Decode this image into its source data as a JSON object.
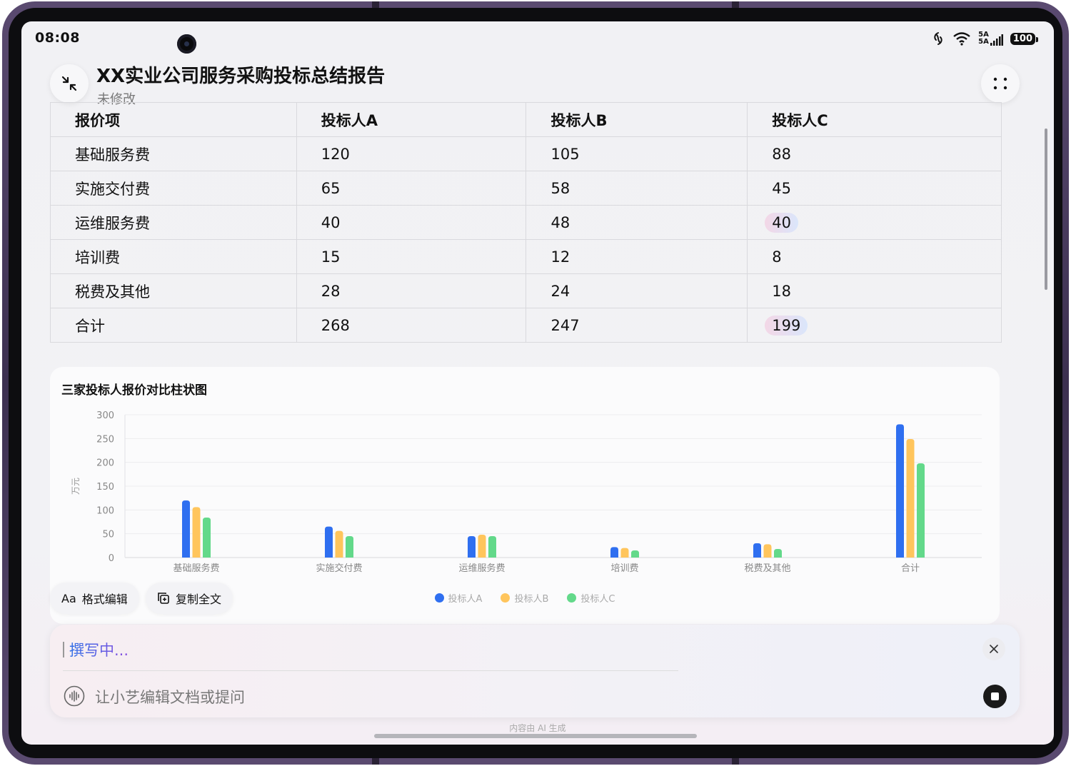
{
  "status_bar": {
    "time": "08:08",
    "network_label": "5A",
    "battery": "100"
  },
  "header": {
    "title": "XX实业公司服务采购投标总结报告",
    "status": "未修改"
  },
  "table": {
    "headers": [
      "报价项",
      "投标人A",
      "投标人B",
      "投标人C"
    ],
    "rows": [
      [
        "基础服务费",
        "120",
        "105",
        "88"
      ],
      [
        "实施交付费",
        "65",
        "58",
        "45"
      ],
      [
        "运维服务费",
        "40",
        "48",
        "40"
      ],
      [
        "培训费",
        "15",
        "12",
        "8"
      ],
      [
        "税费及其他",
        "28",
        "24",
        "18"
      ],
      [
        "合计",
        "268",
        "247",
        "199"
      ]
    ]
  },
  "chart_data": {
    "type": "bar",
    "title": "三家投标人报价对比柱状图",
    "ylabel": "万元",
    "xlabel": "",
    "ylim": [
      0,
      300
    ],
    "yticks": [
      0,
      50,
      100,
      150,
      200,
      250,
      300
    ],
    "categories": [
      "基础服务费",
      "实施交付费",
      "运维服务费",
      "培训费",
      "税费及其他",
      "合计"
    ],
    "series": [
      {
        "name": "投标人A",
        "color": "#2f6ff0",
        "values": [
          120,
          65,
          45,
          22,
          30,
          280
        ]
      },
      {
        "name": "投标人B",
        "color": "#ffc55c",
        "values": [
          106,
          56,
          48,
          20,
          28,
          249
        ]
      },
      {
        "name": "投标人C",
        "color": "#63d98a",
        "values": [
          84,
          45,
          45,
          15,
          18,
          198
        ]
      }
    ],
    "legend_position": "bottom-center",
    "grid": true
  },
  "actions": {
    "format_edit": "格式编辑",
    "format_icon_text": "Aa",
    "copy_all": "复制全文"
  },
  "assistant": {
    "writing_status": "撰写中...",
    "input_placeholder": "让小艺编辑文档或提问",
    "ai_note": "内容由 AI 生成"
  }
}
